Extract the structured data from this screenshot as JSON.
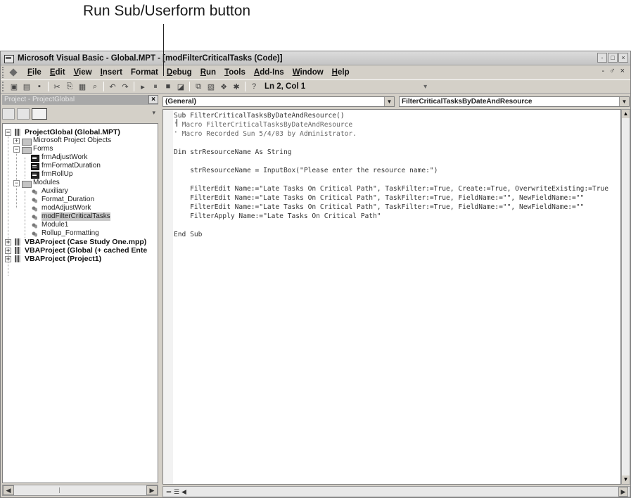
{
  "callout": {
    "label": "Run Sub/Userform button"
  },
  "window": {
    "title": "Microsoft Visual Basic - Global.MPT - [modFilterCriticalTasks (Code)]",
    "controls": [
      "-",
      "□",
      "×"
    ]
  },
  "menu": {
    "items": [
      {
        "u": "F",
        "rest": "ile"
      },
      {
        "u": "E",
        "rest": "dit"
      },
      {
        "u": "V",
        "rest": "iew"
      },
      {
        "u": "I",
        "rest": "nsert"
      },
      {
        "u": "",
        "rest": "Format"
      },
      {
        "u": "D",
        "rest": "ebug"
      },
      {
        "u": "R",
        "rest": "un"
      },
      {
        "u": "T",
        "rest": "ools"
      },
      {
        "u": "A",
        "rest": "dd-Ins"
      },
      {
        "u": "W",
        "rest": "indow"
      },
      {
        "u": "H",
        "rest": "elp"
      }
    ],
    "right": "- ♂ ×"
  },
  "toolbar": {
    "status": "Ln 2, Col 1"
  },
  "project": {
    "title": "Project - ProjectGlobal",
    "close": "×",
    "tree": [
      {
        "label": "ProjectGlobal (Global.MPT)",
        "bold": true,
        "exp": "−",
        "icon": "vba"
      },
      {
        "label": "Microsoft Project Objects",
        "exp": "+",
        "icon": "folder"
      },
      {
        "label": "Forms",
        "exp": "−",
        "icon": "folder"
      },
      {
        "label": "frmAdjustWork",
        "icon": "form"
      },
      {
        "label": "frmFormatDuration",
        "icon": "form"
      },
      {
        "label": "frmRollUp",
        "icon": "form"
      },
      {
        "label": "Modules",
        "exp": "−",
        "icon": "folder"
      },
      {
        "label": "Auxiliary",
        "icon": "module"
      },
      {
        "label": "Format_Duration",
        "icon": "module"
      },
      {
        "label": "modAdjustWork",
        "icon": "module"
      },
      {
        "label": "modFilterCriticalTasks",
        "icon": "module",
        "selected": true
      },
      {
        "label": "Module1",
        "icon": "module"
      },
      {
        "label": "Rollup_Formatting",
        "icon": "module"
      },
      {
        "label": "VBAProject (Case Study One.mpp)",
        "bold": true,
        "exp": "+",
        "icon": "vba"
      },
      {
        "label": "VBAProject (Global (+ cached Ente",
        "bold": true,
        "exp": "+",
        "icon": "vba"
      },
      {
        "label": "VBAProject (Project1)",
        "bold": true,
        "exp": "+",
        "icon": "vba"
      }
    ]
  },
  "code": {
    "object_combo": "(General)",
    "proc_combo": "FilterCriticalTasksByDateAndResource",
    "lines": [
      {
        "text": "Sub FilterCriticalTasksByDateAndResource()",
        "type": "code"
      },
      {
        "text": "' Macro FilterCriticalTasksByDateAndResource",
        "type": "comment"
      },
      {
        "text": "' Macro Recorded Sun 5/4/03 by Administrator.",
        "type": "comment"
      },
      {
        "text": "",
        "type": "code"
      },
      {
        "text": "Dim strResourceName As String",
        "type": "code"
      },
      {
        "text": "",
        "type": "code"
      },
      {
        "text": "    strResourceName = InputBox(\"Please enter the resource name:\")",
        "type": "code"
      },
      {
        "text": "",
        "type": "code"
      },
      {
        "text": "    FilterEdit Name:=\"Late Tasks On Critical Path\", TaskFilter:=True, Create:=True, OverwriteExisting:=True",
        "type": "code"
      },
      {
        "text": "    FilterEdit Name:=\"Late Tasks On Critical Path\", TaskFilter:=True, FieldName:=\"\", NewFieldName:=\"\"",
        "type": "code"
      },
      {
        "text": "    FilterEdit Name:=\"Late Tasks On Critical Path\", TaskFilter:=True, FieldName:=\"\", NewFieldName:=\"\"",
        "type": "code"
      },
      {
        "text": "    FilterApply Name:=\"Late Tasks On Critical Path\"",
        "type": "code"
      },
      {
        "text": "",
        "type": "code"
      },
      {
        "text": "End Sub",
        "type": "code"
      }
    ]
  }
}
